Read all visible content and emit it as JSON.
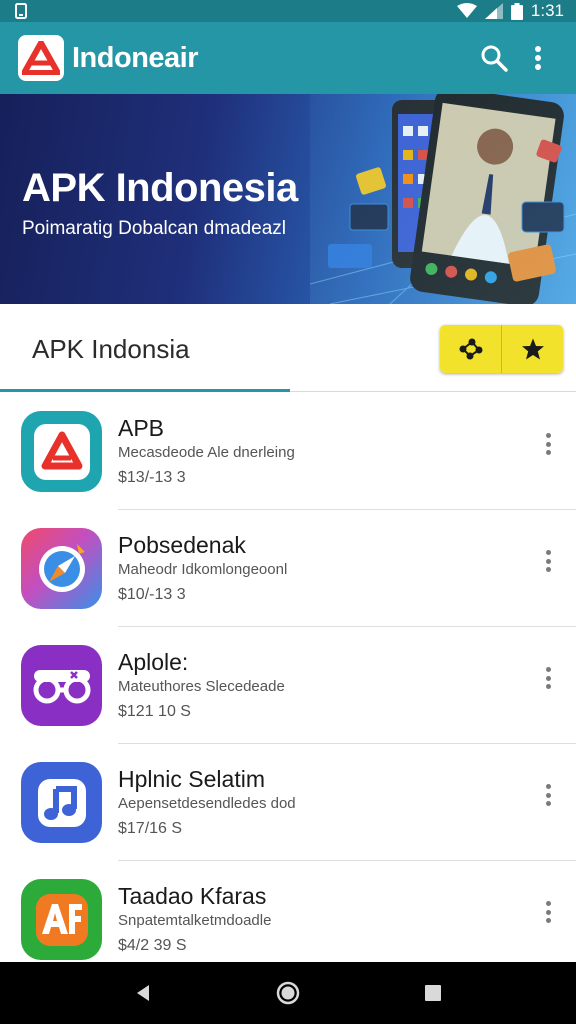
{
  "status_bar": {
    "time": "1:31"
  },
  "app_bar": {
    "title": "Indoneair"
  },
  "banner": {
    "title": "APK Indonesia",
    "subtitle": "Poimaratig Dobalcan dmadeazl"
  },
  "section": {
    "title": "APK Indonsia"
  },
  "apps": [
    {
      "name": "APB",
      "description": "Mecasdeode Ale dnerleing",
      "price": "$13/-13 3",
      "icon": "red-triangle-icon",
      "colors": [
        "#1aa7b0",
        "#0e7f8c"
      ]
    },
    {
      "name": "Pobsedenak",
      "description": "Maheodr Idkomlongeoonl",
      "price": "$10/-13 3",
      "icon": "compass-icon",
      "colors": [
        "#e7466f",
        "#3a8ee6"
      ]
    },
    {
      "name": "Aplole:",
      "description": "Mateuthores Slecedeade",
      "price": "$121 10 S",
      "icon": "glasses-icon",
      "colors": [
        "#8a2fc4",
        "#6a1fa8"
      ]
    },
    {
      "name": "Hplnic Selatim",
      "description": "Aepensetdesendledes dod",
      "price": "$17/16 S",
      "icon": "music-note-icon",
      "colors": [
        "#3d63d6",
        "#2947a8"
      ]
    },
    {
      "name": "Taadao Kfaras",
      "description": "Snpatemtalketmdoadle",
      "price": "$4/2 39 S",
      "icon": "af-letters-icon",
      "colors": [
        "#2cab3a",
        "#1b8a2a"
      ]
    }
  ],
  "colors": {
    "primary": "#2596a6",
    "status_bar": "#1c7c87",
    "accent_chip": "#f2e22c"
  }
}
